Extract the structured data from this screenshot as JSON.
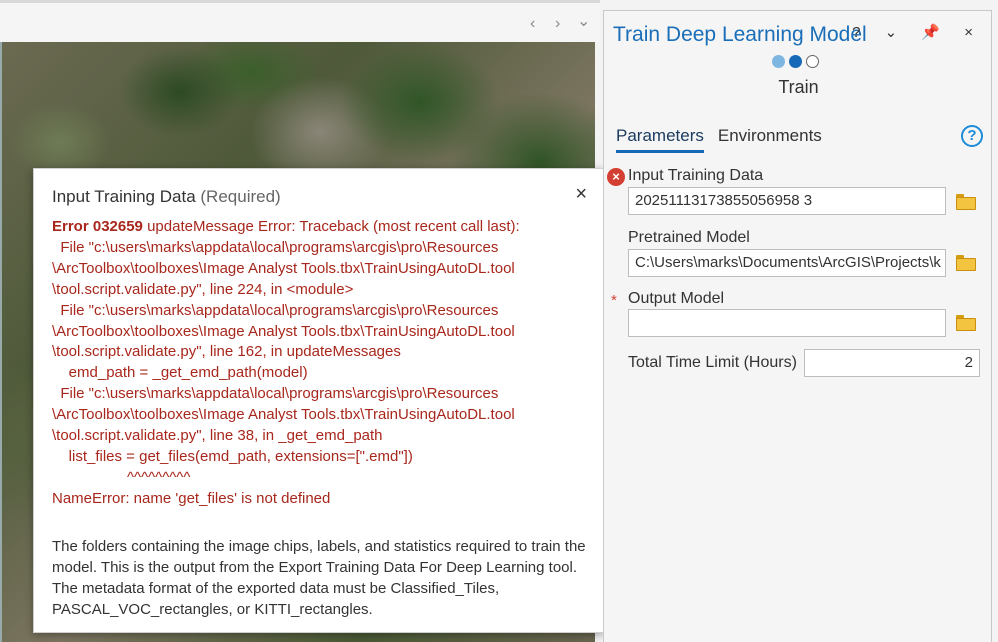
{
  "map": {
    "nav_prev_icon": "chevron-left-icon",
    "nav_prev": "‹",
    "nav_next_icon": "chevron-right-icon",
    "nav_next": "›",
    "nav_menu_icon": "chevron-down-icon",
    "nav_menu": "⌄"
  },
  "popup": {
    "title": "Input Training Data",
    "title_suffix": "(Required)",
    "close": "×",
    "error_code": "Error 032659",
    "error_body": " updateMessage Error: Traceback (most recent call last):\n  File \"c:\\users\\marks\\appdata\\local\\programs\\arcgis\\pro\\Resources\n\\ArcToolbox\\toolboxes\\Image Analyst Tools.tbx\\TrainUsingAutoDL.tool\n\\tool.script.validate.py\", line 224, in <module>\n  File \"c:\\users\\marks\\appdata\\local\\programs\\arcgis\\pro\\Resources\n\\ArcToolbox\\toolboxes\\Image Analyst Tools.tbx\\TrainUsingAutoDL.tool\n\\tool.script.validate.py\", line 162, in updateMessages\n    emd_path = _get_emd_path(model)\n  File \"c:\\users\\marks\\appdata\\local\\programs\\arcgis\\pro\\Resources\n\\ArcToolbox\\toolboxes\\Image Analyst Tools.tbx\\TrainUsingAutoDL.tool\n\\tool.script.validate.py\", line 38, in _get_emd_path\n    list_files = get_files(emd_path, extensions=[\".emd\"])\n                  ^^^^^^^^^\nNameError: name 'get_files' is not defined",
    "description": "The folders containing the image chips, labels, and statistics required to train the model. This is the output from the Export Training Data For Deep Learning tool. The metadata format of the exported data must be Classified_Tiles, PASCAL_VOC_rectangles, or KITTI_rectangles."
  },
  "pane": {
    "title": "Train Deep Learning Model",
    "tools": "? ⌄ 📌 ×",
    "step_label": "Train",
    "tabs": [
      "Parameters",
      "Environments"
    ],
    "help": "?",
    "params": {
      "input_training_data": {
        "label": "Input Training Data",
        "value": "20251113173855056958 3"
      },
      "pretrained_model": {
        "label": "Pretrained Model",
        "value": "C:\\Users\\marks\\Documents\\ArcGIS\\Projects\\k"
      },
      "output_model": {
        "label": "Output Model",
        "value": ""
      },
      "total_time_limit": {
        "label": "Total Time Limit (Hours)",
        "value": "2"
      }
    },
    "error_icon_glyph": "×",
    "required_star": "*",
    "colors": {
      "accent": "#1a6eb8",
      "error": "#d33f32",
      "error_text": "#a8271c"
    }
  }
}
